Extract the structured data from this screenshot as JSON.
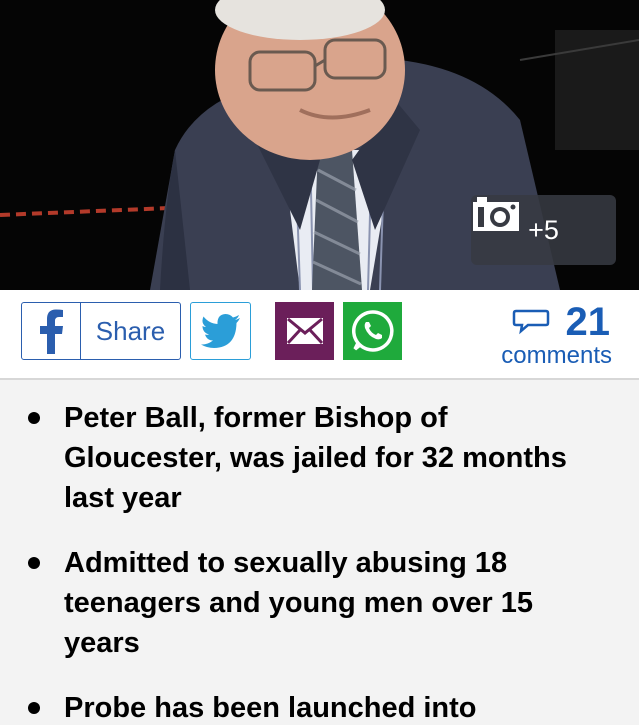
{
  "hero": {
    "gallery_count": "+5",
    "camera_icon": "camera-icon"
  },
  "share": {
    "facebook_label": "Share",
    "icons": [
      "facebook-icon",
      "twitter-icon",
      "mail-icon",
      "whatsapp-icon"
    ],
    "colors": {
      "facebook": "#2b5eae",
      "twitter": "#2b9ed8",
      "mail": "#6b1f5a",
      "whatsapp": "#1faa3c"
    }
  },
  "comments": {
    "count": "21",
    "label": "comments",
    "color": "#1a5db5"
  },
  "summary": {
    "bullets": [
      "Peter Ball, former Bishop of Gloucester, was jailed for 32 months last year",
      "Admitted to sexually abusing 18 teenagers and young men over 15 years",
      "Probe has been launched into"
    ]
  }
}
